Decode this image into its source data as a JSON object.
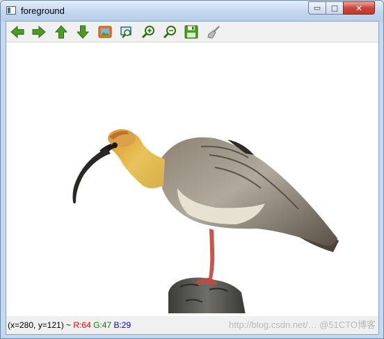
{
  "window": {
    "title": "foreground",
    "controls": {
      "minimize": "▭",
      "maximize": "□",
      "close": "✕"
    }
  },
  "toolbar": {
    "buttons": [
      {
        "name": "pan-left",
        "icon": "arrow-left-icon"
      },
      {
        "name": "pan-right",
        "icon": "arrow-right-icon"
      },
      {
        "name": "pan-up",
        "icon": "arrow-up-icon"
      },
      {
        "name": "pan-down",
        "icon": "arrow-down-icon"
      },
      {
        "name": "zoom-fit",
        "icon": "image-icon"
      },
      {
        "name": "zoom-rect",
        "icon": "zoom-region-icon"
      },
      {
        "name": "zoom-in",
        "icon": "zoom-in-icon"
      },
      {
        "name": "zoom-out",
        "icon": "zoom-out-icon"
      },
      {
        "name": "save",
        "icon": "save-icon"
      },
      {
        "name": "properties",
        "icon": "brush-icon"
      }
    ],
    "colors": {
      "green": "#4e9a26",
      "green_dark": "#2f6e12",
      "orange": "#e07a1f",
      "blue": "#2563a8"
    }
  },
  "status": {
    "coords": "(x=280, y=121) ~",
    "r": "R:64",
    "g": "G:47",
    "b": "B:29",
    "colors": {
      "r": "#ff0000",
      "g": "#008000",
      "b": "#0000ff"
    }
  },
  "watermark": "http://blog.csdn.net/… @51CTO博客"
}
